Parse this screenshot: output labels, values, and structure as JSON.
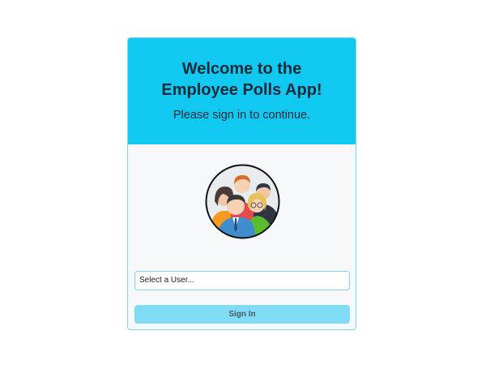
{
  "login": {
    "title_line1": "Welcome to the",
    "title_line2": "Employee Polls App!",
    "subtitle": "Please sign in to continue.",
    "select_placeholder": "Select a User...",
    "signin_label": "Sign In"
  },
  "colors": {
    "header_bg": "#10c8f0",
    "button_bg": "#80dcf5",
    "border": "#7fd3ee"
  },
  "icons": {
    "avatar": "employee-group-icon"
  }
}
